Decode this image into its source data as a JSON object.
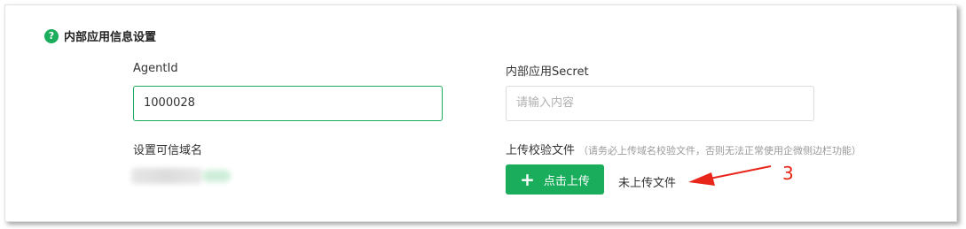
{
  "section": {
    "title": "内部应用信息设置",
    "help_glyph": "?"
  },
  "agent_id": {
    "label": "AgentId",
    "value": "1000028"
  },
  "secret": {
    "label": "内部应用Secret",
    "placeholder": "请输入内容"
  },
  "trusted_domain": {
    "label": "设置可信域名"
  },
  "verify_file": {
    "label": "上传校验文件",
    "hint": "（请务必上传域名校验文件，否则无法正常使用企微侧边栏功能）",
    "upload_button": "点击上传",
    "status": "未上传文件"
  },
  "annotation": {
    "number": "3",
    "color": "#e8261a"
  },
  "colors": {
    "accent": "#1aad5c"
  }
}
